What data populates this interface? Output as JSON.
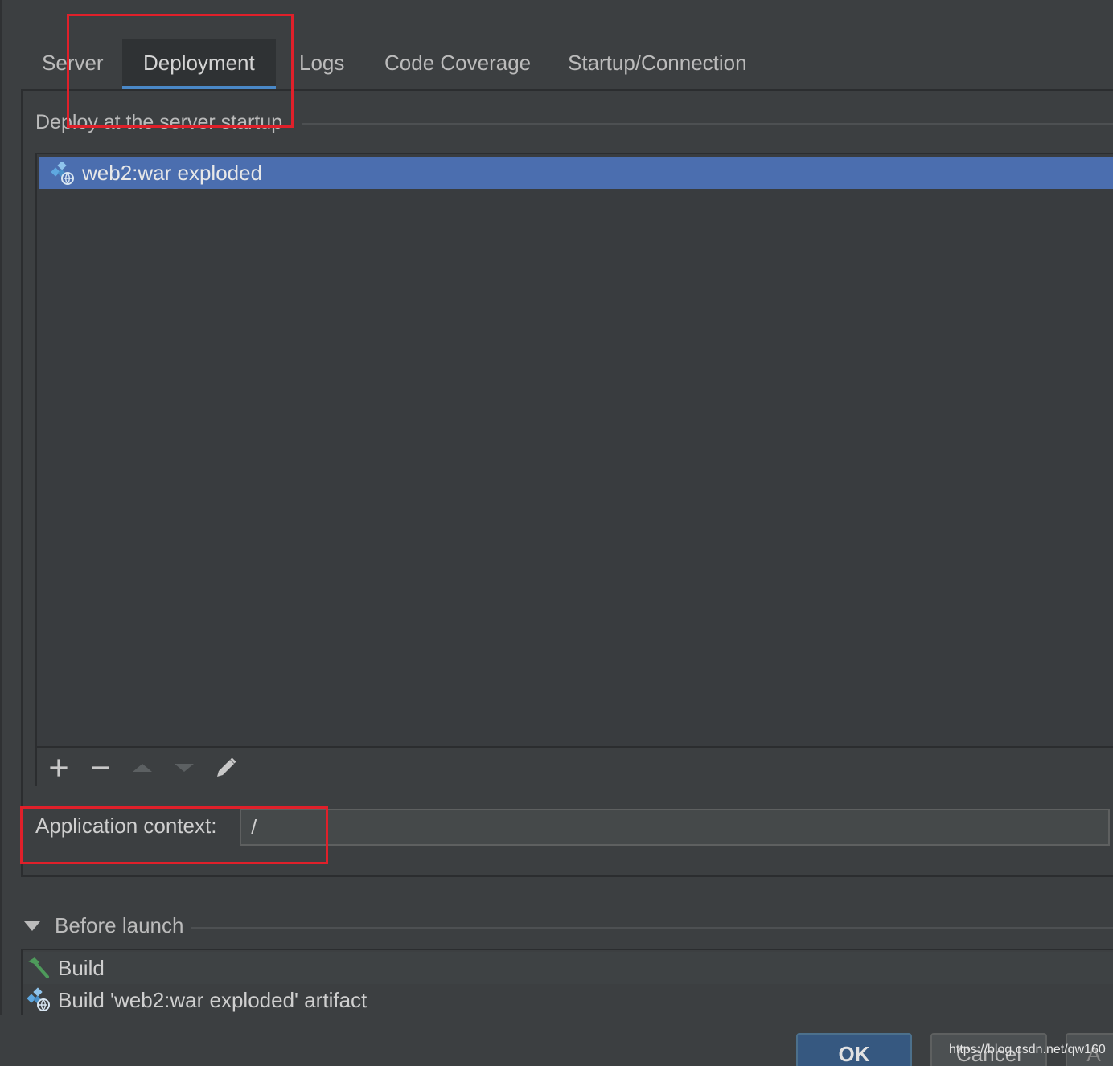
{
  "tabs": [
    {
      "label": "Server"
    },
    {
      "label": "Deployment",
      "active": true
    },
    {
      "label": "Logs"
    },
    {
      "label": "Code Coverage"
    },
    {
      "label": "Startup/Connection"
    }
  ],
  "deploy": {
    "group_title": "Deploy at the server startup",
    "items": [
      {
        "label": "web2:war exploded",
        "icon": "artifact-icon",
        "selected": true
      }
    ],
    "toolbar": {
      "add_icon": "plus-icon",
      "remove_icon": "minus-icon",
      "up_icon": "arrow-up-icon",
      "down_icon": "arrow-down-icon",
      "edit_icon": "pencil-icon"
    }
  },
  "app_context": {
    "label": "Application context:",
    "value": "/"
  },
  "before_launch": {
    "title": "Before launch",
    "expanded": true,
    "items": [
      {
        "label": "Build",
        "icon": "hammer-icon"
      },
      {
        "label": "Build 'web2:war exploded' artifact",
        "icon": "artifact-icon"
      }
    ]
  },
  "buttons": {
    "ok": "OK",
    "cancel": "Cancel",
    "apply": "A"
  },
  "watermark": "https://blog.csdn.net/qw160",
  "colors": {
    "background": "#3c3f41",
    "selection": "#4b6eaf",
    "tab_underline": "#4a88c7",
    "highlight_box": "#e0202a",
    "ok_button": "#365880"
  }
}
